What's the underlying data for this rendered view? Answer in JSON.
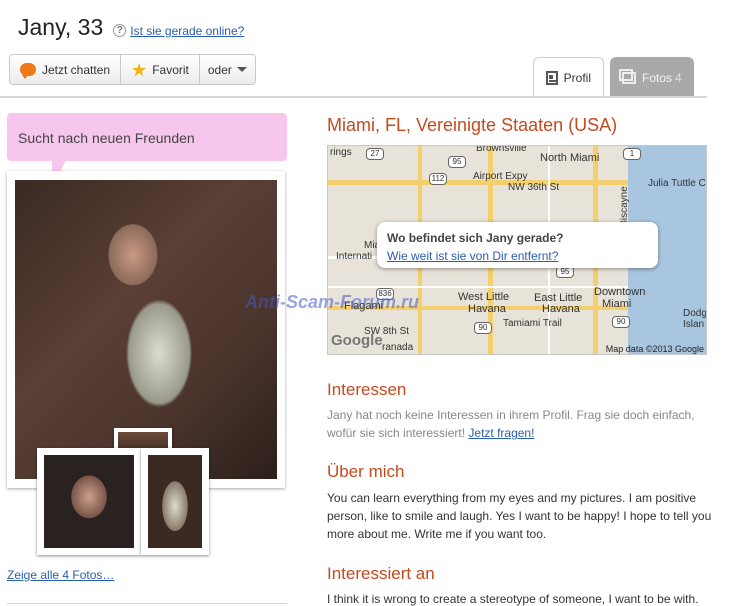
{
  "header": {
    "title": "Jany, 33",
    "help_icon_glyph": "?",
    "online_link": "Ist sie gerade online?"
  },
  "actions": {
    "chat_label": "Jetzt chatten",
    "favorite_label": "Favorit",
    "more_label": "oder"
  },
  "tabs": [
    {
      "label": "Profil",
      "icon": "profile-icon"
    },
    {
      "label": "Fotos",
      "count": "4",
      "icon": "photos-icon"
    }
  ],
  "status_bubble": "Sucht nach neuen Freunden",
  "photos_link": "Zeige alle 4 Fotos…",
  "location": "Miami, FL, Vereinigte Staaten (USA)",
  "map": {
    "popup_title": "Wo befindet sich Jany gerade?",
    "popup_link": "Wie weit ist sie von Dir entfernt?",
    "logo": "Google",
    "copyright": "Map data ©2013 Google",
    "labels": {
      "rings": "rings",
      "brownsville": "Brownsville",
      "north_miami": "North Miami",
      "airport_expy": "Airport Expy",
      "nw36": "NW 36th St",
      "julia": "Julia Tuttle Ca",
      "miami_intl": "Miami",
      "intl": "Internati",
      "flagami": "Flagami",
      "west_little_havana": "West Little",
      "havana": "Havana",
      "east_little_havana": "East Little",
      "havana2": "Havana",
      "downtown": "Downtown",
      "miami2": "Miami",
      "sw8": "SW 8th St",
      "tamiami": "Tamiami Trail",
      "granada": "ranada",
      "dodge": "Dodg",
      "island": "Islan",
      "biscayne": "Biscayne"
    },
    "shields": [
      "27",
      "112",
      "95",
      "836",
      "1",
      "90",
      "90",
      "95"
    ]
  },
  "watermark": "Anti-Scam-Forum.ru",
  "sections": {
    "interests_heading": "Interessen",
    "interests_text": "Jany hat noch keine Interessen in ihrem Profil. Frag sie doch einfach, wofür sie sich interessiert!",
    "interests_link": "Jetzt fragen!",
    "about_heading": "Über mich",
    "about_text": "You can learn everything from my eyes and my pictures. I am positive person, like to smile and laugh. Yes I want to be happy! I hope to tell you more about me. Write me if you want too.",
    "interested_heading": "Interessiert an",
    "interested_text": "I think it is wrong to create a stereotype of someone, I want to be with."
  },
  "colors": {
    "heading": "#c44a1f",
    "link": "#2a5db0",
    "bubble": "#f7c6ec",
    "tab_inactive": "#a9a9a9"
  }
}
